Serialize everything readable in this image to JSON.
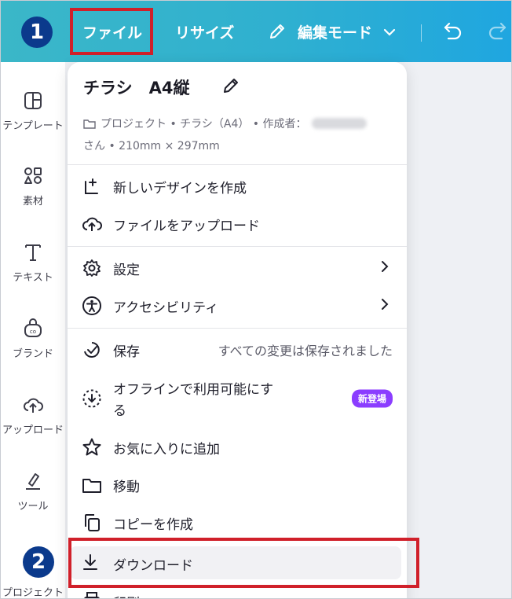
{
  "topbar": {
    "file_label": "ファイル",
    "resize_label": "リサイズ",
    "edit_mode_label": "編集モード"
  },
  "callouts": {
    "step1": "1",
    "step2": "2"
  },
  "sidebar": {
    "items": [
      {
        "label": "テンプレート",
        "icon": "template-icon"
      },
      {
        "label": "素材",
        "icon": "elements-icon"
      },
      {
        "label": "テキスト",
        "icon": "text-icon"
      },
      {
        "label": "ブランド",
        "icon": "brand-icon"
      },
      {
        "label": "アップロード",
        "icon": "upload-cloud-icon"
      },
      {
        "label": "ツール",
        "icon": "tools-icon"
      },
      {
        "label": "プロジェクト",
        "icon": "project-icon"
      }
    ]
  },
  "menu": {
    "title": "チラシ　A4縦",
    "meta_line1": "プロジェクト • チラシ（A4） • 作成者：",
    "meta_line2": "さん • 210mm × 297mm",
    "items": {
      "new_design": "新しいデザインを作成",
      "upload_file": "ファイルをアップロード",
      "settings": "設定",
      "accessibility": "アクセシビリティ",
      "save": "保存",
      "save_status": "すべての変更は保存されました",
      "offline_1": "オフラインで利用可能にす",
      "offline_2": "る",
      "offline_badge": "新登場",
      "favorite": "お気に入りに追加",
      "move": "移動",
      "copy": "コピーを作成",
      "download": "ダウンロード",
      "print": "印刷"
    }
  },
  "colors": {
    "header_start": "#3bb7c8",
    "header_end": "#1fa6e0",
    "callout": "#0b3a8c",
    "highlight": "#d0202a",
    "badge": "#8b3dff"
  }
}
